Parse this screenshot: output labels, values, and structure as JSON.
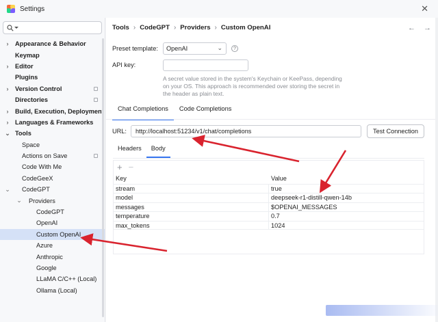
{
  "window": {
    "title": "Settings"
  },
  "search": {
    "value": "",
    "placeholder": ""
  },
  "sidebar": {
    "items": [
      {
        "label": "Appearance & Behavior",
        "bold": true,
        "chevron": "›",
        "indent": 0
      },
      {
        "label": "Keymap",
        "bold": true,
        "chevron": "",
        "indent": 0
      },
      {
        "label": "Editor",
        "bold": true,
        "chevron": "›",
        "indent": 0
      },
      {
        "label": "Plugins",
        "bold": true,
        "chevron": "",
        "indent": 0
      },
      {
        "label": "Version Control",
        "bold": true,
        "chevron": "›",
        "indent": 0,
        "badge": true
      },
      {
        "label": "Directories",
        "bold": true,
        "chevron": "",
        "indent": 0,
        "badge": true
      },
      {
        "label": "Build, Execution, Deployment",
        "bold": true,
        "chevron": "›",
        "indent": 0
      },
      {
        "label": "Languages & Frameworks",
        "bold": true,
        "chevron": "›",
        "indent": 0
      },
      {
        "label": "Tools",
        "bold": true,
        "chevron": "⌄",
        "indent": 0
      },
      {
        "label": "Space",
        "bold": false,
        "chevron": "",
        "indent": 1
      },
      {
        "label": "Actions on Save",
        "bold": false,
        "chevron": "",
        "indent": 1,
        "badge": true
      },
      {
        "label": "Code With Me",
        "bold": false,
        "chevron": "",
        "indent": 1
      },
      {
        "label": "CodeGeeX",
        "bold": false,
        "chevron": "",
        "indent": 1
      },
      {
        "label": "CodeGPT",
        "bold": false,
        "chevron": "⌄",
        "indent": 1
      },
      {
        "label": "Providers",
        "bold": false,
        "chevron": "⌄",
        "indent": 2
      },
      {
        "label": "CodeGPT",
        "bold": false,
        "chevron": "",
        "indent": 3
      },
      {
        "label": "OpenAI",
        "bold": false,
        "chevron": "",
        "indent": 3
      },
      {
        "label": "Custom OpenAI",
        "bold": false,
        "chevron": "",
        "indent": 3,
        "selected": true
      },
      {
        "label": "Azure",
        "bold": false,
        "chevron": "",
        "indent": 3
      },
      {
        "label": "Anthropic",
        "bold": false,
        "chevron": "",
        "indent": 3
      },
      {
        "label": "Google",
        "bold": false,
        "chevron": "",
        "indent": 3
      },
      {
        "label": "LLaMA C/C++ (Local)",
        "bold": false,
        "chevron": "",
        "indent": 3
      },
      {
        "label": "Ollama (Local)",
        "bold": false,
        "chevron": "",
        "indent": 3
      }
    ]
  },
  "breadcrumb": [
    "Tools",
    "CodeGPT",
    "Providers",
    "Custom OpenAI"
  ],
  "form": {
    "preset_label": "Preset template:",
    "preset_value": "OpenAI",
    "apikey_label": "API key:",
    "apikey_value": "",
    "apikey_hint": "A secret value stored in the system's Keychain or KeePass, depending on your OS. This approach is recommended over storing the secret in the header as plain text."
  },
  "tabs": [
    {
      "label": "Chat Completions",
      "active": true
    },
    {
      "label": "Code Completions",
      "active": false
    }
  ],
  "url": {
    "label": "URL:",
    "value": "http://localhost:51234/v1/chat/completions",
    "test_button": "Test Connection"
  },
  "subtabs": [
    {
      "label": "Headers",
      "active": false
    },
    {
      "label": "Body",
      "active": true
    }
  ],
  "body_table": {
    "add_icon": "+",
    "remove_icon": "−",
    "headers": [
      "Key",
      "Value"
    ],
    "rows": [
      {
        "key": "stream",
        "value": "true"
      },
      {
        "key": "model",
        "value": "deepseek-r1-distill-qwen-14b"
      },
      {
        "key": "messages",
        "value": "$OPENAI_MESSAGES"
      },
      {
        "key": "temperature",
        "value": "0.7"
      },
      {
        "key": "max_tokens",
        "value": "1024"
      }
    ]
  },
  "help_label": "?",
  "annotation_color": "#d9232e",
  "accent_color": "#3574f0"
}
